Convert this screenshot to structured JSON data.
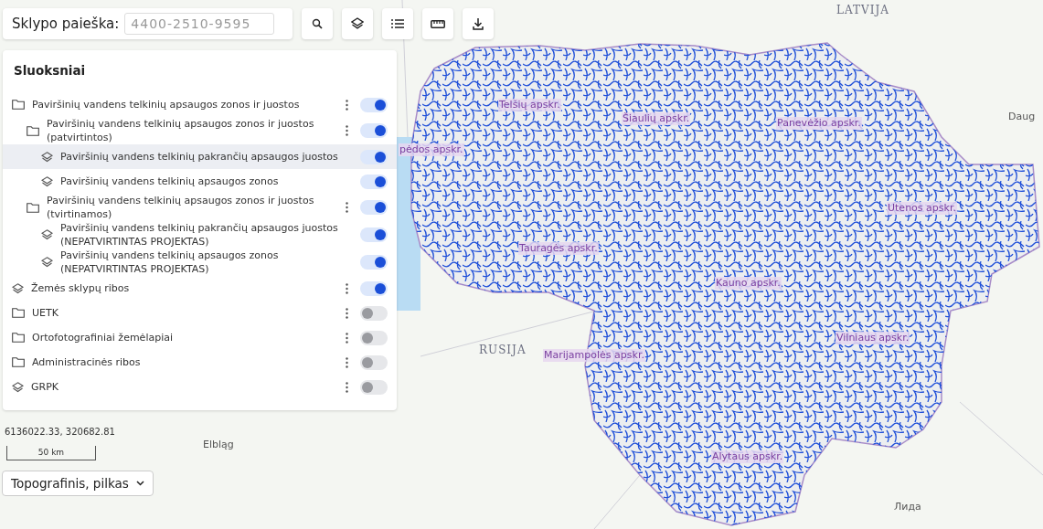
{
  "search": {
    "label": "Sklypo paieška:",
    "placeholder": "4400-2510-9595"
  },
  "layers": {
    "title": "Sluoksniai",
    "items": [
      {
        "label": "Paviršinių vandens telkinių apsaugos zonos ir juostos",
        "kind": "folder",
        "menu": true,
        "on": true,
        "highlighted": false,
        "children": [
          {
            "label": "Paviršinių vandens telkinių apsaugos zonos ir juostos (patvirtintos)",
            "kind": "folder",
            "menu": true,
            "on": true,
            "highlighted": false,
            "children": [
              {
                "label": "Paviršinių vandens telkinių pakrančių apsaugos juostos",
                "kind": "layer",
                "menu": false,
                "on": true,
                "highlighted": true
              },
              {
                "label": "Paviršinių vandens telkinių apsaugos zonos",
                "kind": "layer",
                "menu": false,
                "on": true,
                "highlighted": false
              }
            ]
          },
          {
            "label": "Paviršinių vandens telkinių apsaugos zonos ir juostos (tvirtinamos)",
            "kind": "folder",
            "menu": true,
            "on": true,
            "highlighted": false,
            "children": [
              {
                "label": "Paviršinių vandens telkinių pakrančių apsaugos juostos (NEPATVIRTINTAS PROJEKTAS)",
                "kind": "layer",
                "menu": false,
                "on": true,
                "highlighted": false
              },
              {
                "label": "Paviršinių vandens telkinių apsaugos zonos (NEPATVIRTINTAS PROJEKTAS)",
                "kind": "layer",
                "menu": false,
                "on": true,
                "highlighted": false
              }
            ]
          }
        ]
      },
      {
        "label": "Žemės sklypų ribos",
        "kind": "layer",
        "menu": true,
        "on": true,
        "highlighted": false
      },
      {
        "label": "UETK",
        "kind": "folder",
        "menu": true,
        "on": false,
        "highlighted": false
      },
      {
        "label": "Ortofotografiniai žemėlapiai",
        "kind": "folder",
        "menu": true,
        "on": false,
        "highlighted": false
      },
      {
        "label": "Administracinės ribos",
        "kind": "folder",
        "menu": true,
        "on": false,
        "highlighted": false
      },
      {
        "label": "GRPK",
        "kind": "layer",
        "menu": true,
        "on": false,
        "highlighted": false
      }
    ]
  },
  "coordinates": "6136022.33, 320682.81",
  "scale": "50 km",
  "basemap": "Topografinis, pilkas",
  "map": {
    "labels": [
      {
        "text": "LATVIJA",
        "kind": "country"
      },
      {
        "text": "Telšių apskr.",
        "kind": "region"
      },
      {
        "text": "Šiaulių apskr.",
        "kind": "region"
      },
      {
        "text": "Panevėžio apskr.",
        "kind": "region"
      },
      {
        "text": "Daug",
        "kind": "city"
      },
      {
        "text": "pėdos apskr.",
        "kind": "region"
      },
      {
        "text": "Utenos apskr.",
        "kind": "region"
      },
      {
        "text": "Tauragės apskr.",
        "kind": "region"
      },
      {
        "text": "Kauno apskr.",
        "kind": "region"
      },
      {
        "text": "RUSIJA",
        "kind": "country"
      },
      {
        "text": "Marijampolės apskr.",
        "kind": "region"
      },
      {
        "text": "Vilniaus apskr.",
        "kind": "region"
      },
      {
        "text": "Alytaus apskr.",
        "kind": "region"
      },
      {
        "text": "Elbląg",
        "kind": "city"
      },
      {
        "text": "Лида",
        "kind": "city"
      }
    ]
  }
}
